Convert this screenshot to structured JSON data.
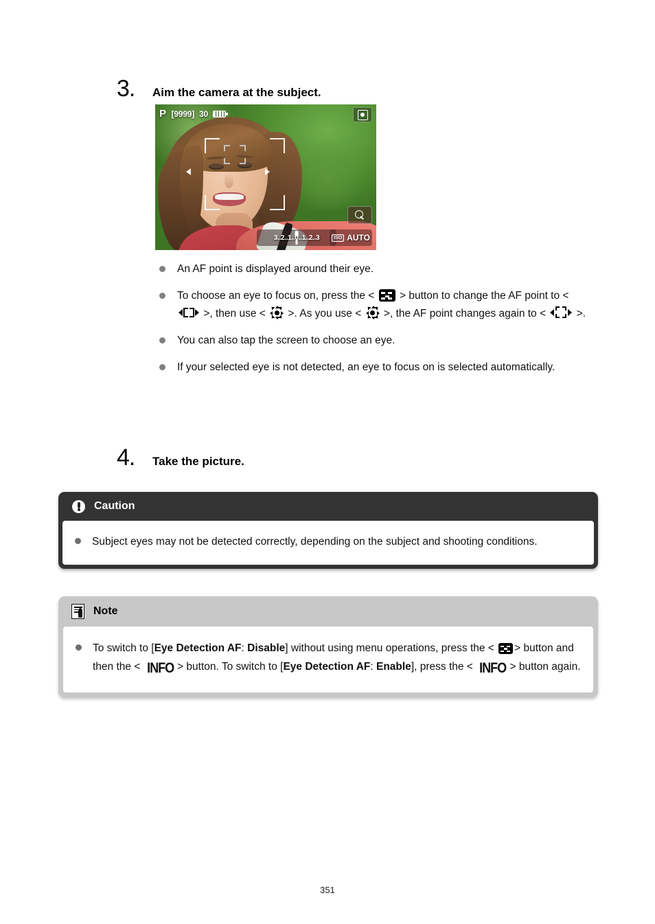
{
  "document": {
    "page_number": "351"
  },
  "steps": [
    {
      "number": "3.",
      "title": "Aim the camera at the subject."
    },
    {
      "number": "4.",
      "title": "Take the picture."
    }
  ],
  "camera_screen": {
    "shooting_mode": "P",
    "shots_remaining": "[9999]",
    "shutter_speed": "30",
    "battery_icon": "battery-icon",
    "quick_control_icon": "quick-control-icon",
    "magnify_icon": "magnify-icon",
    "exposure_scale": "3..2..1..0..1..2..3",
    "iso_badge": "ISO",
    "iso_value": "AUTO"
  },
  "bullets": [
    {
      "id": "af-point-eye",
      "parts": [
        {
          "type": "text",
          "value": "An AF point is displayed around their eye."
        }
      ]
    },
    {
      "id": "choose-eye",
      "parts": [
        {
          "type": "text",
          "value": "To choose an eye to focus on, press the < "
        },
        {
          "type": "icon",
          "value": "af-point-select-icon"
        },
        {
          "type": "text",
          "value": " > button to change the AF point to < "
        },
        {
          "type": "icon",
          "value": "flexible-zone-af-icon"
        },
        {
          "type": "text",
          "value": " >, then use < "
        },
        {
          "type": "icon",
          "value": "multi-controller-icon"
        },
        {
          "type": "text",
          "value": " >. As you use < "
        },
        {
          "type": "icon",
          "value": "multi-controller-icon"
        },
        {
          "type": "text",
          "value": " >, the AF point changes again to < "
        },
        {
          "type": "icon",
          "value": "zone-af-icon"
        },
        {
          "type": "text",
          "value": " >."
        }
      ]
    },
    {
      "id": "tap-screen",
      "parts": [
        {
          "type": "text",
          "value": "You can also tap the screen to choose an eye."
        }
      ]
    },
    {
      "id": "not-detected",
      "parts": [
        {
          "type": "text",
          "value": "If your selected eye is not detected, an eye to focus on is selected automatically."
        }
      ]
    }
  ],
  "bullet_text": {
    "b1": "An AF point is displayed around their eye.",
    "b2_a": "To choose an eye to focus on, press the <",
    "b2_b": "> button to change the AF point to <",
    "b2_c": ">, then use <",
    "b2_d": ">. As you use <",
    "b2_e": ">, the AF point changes again to <",
    "b2_f": ">.",
    "b3": "You can also tap the screen to choose an eye.",
    "b4": "If your selected eye is not detected, an eye to focus on is selected automatically."
  },
  "caution": {
    "icon": "caution-icon",
    "title": "Caution",
    "body": "Subject eyes may not be detected correctly, depending on the subject and shooting conditions."
  },
  "note": {
    "icon": "note-icon",
    "title": "Note",
    "text": {
      "a": "To switch to [",
      "b_bold": "Eye Detection AF",
      "c": ": ",
      "d_bold": "Disable",
      "e": "] without using menu operations, press the <",
      "f": "> button and then the <",
      "g": "> button. To switch to [",
      "h_bold": "Eye Detection AF",
      "i": ": ",
      "j_bold": "Enable",
      "k": "], press the <",
      "l": "> button again.",
      "info_glyph": "INFO"
    }
  },
  "colors": {
    "caution_header_bg": "#333333",
    "note_header_bg": "#c8c8c8",
    "bullet_dot": "#808080",
    "page_bg": "#ffffff"
  }
}
